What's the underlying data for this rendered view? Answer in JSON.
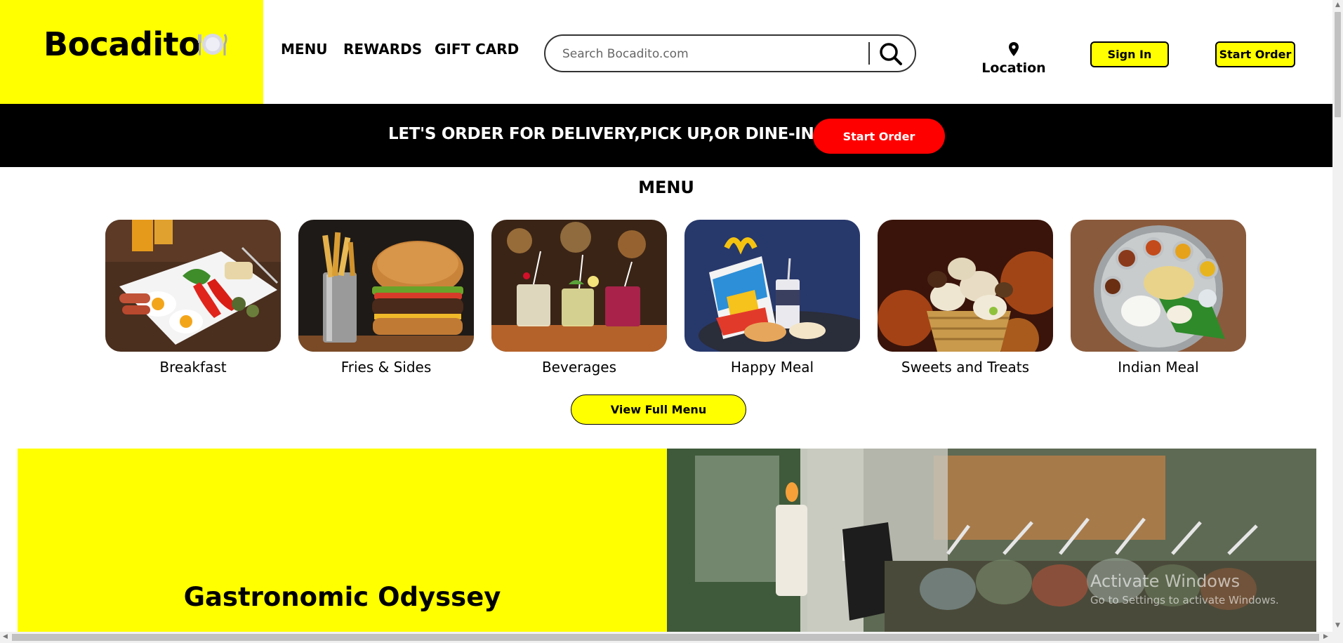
{
  "header": {
    "logo_text": "Bocadito",
    "nav": [
      "MENU",
      "REWARDS",
      "GIFT CARD"
    ],
    "search_placeholder": "Search Bocadito.com",
    "location_label": "Location",
    "sign_in_label": "Sign In",
    "start_order_label": "Start Order"
  },
  "banner": {
    "text": "LET'S ORDER FOR DELIVERY,PICK UP,OR DINE-IN",
    "button_label": "Start Order"
  },
  "menu": {
    "title": "MENU",
    "items": [
      {
        "label": "Breakfast"
      },
      {
        "label": "Fries & Sides"
      },
      {
        "label": "Beverages"
      },
      {
        "label": "Happy Meal"
      },
      {
        "label": "Sweets and Treats"
      },
      {
        "label": "Indian Meal"
      }
    ],
    "full_menu_label": "View Full Menu"
  },
  "feature": {
    "title": "Gastronomic Odyssey"
  },
  "watermark": {
    "line1": "Activate Windows",
    "line2": "Go to Settings to activate Windows."
  },
  "colors": {
    "brand_yellow": "#ffff00",
    "banner_black": "#000000",
    "accent_red": "#ff0000"
  }
}
